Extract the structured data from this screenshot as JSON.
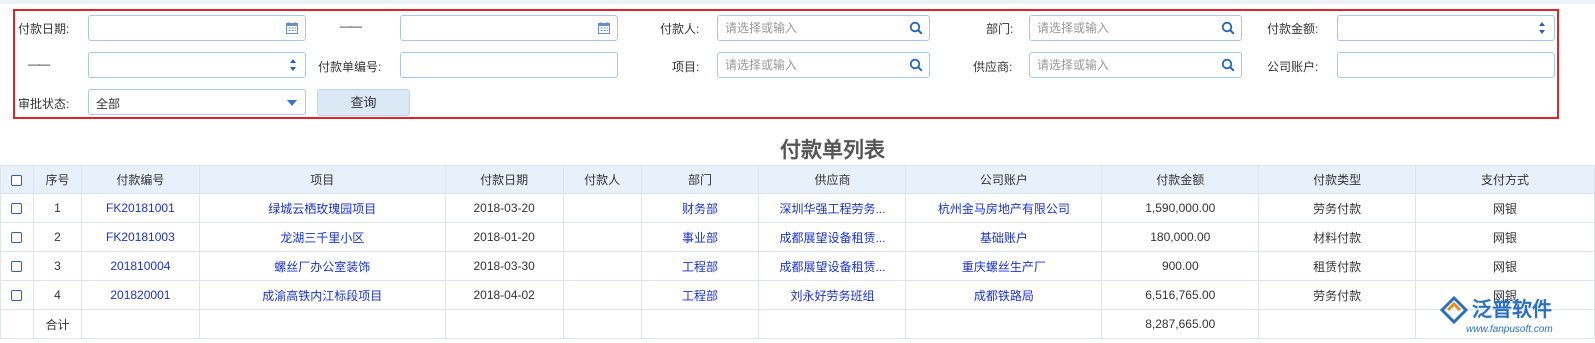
{
  "filters": {
    "payment_date_label": "付款日期:",
    "range_dash": "——",
    "payer_label": "付款人:",
    "payer_placeholder": "请选择或输入",
    "department_label": "部门:",
    "department_placeholder": "请选择或输入",
    "amount_label": "付款金额:",
    "amount_range_dash": "——",
    "doc_no_label": "付款单编号:",
    "project_label": "项目:",
    "project_placeholder": "请选择或输入",
    "supplier_label": "供应商:",
    "supplier_placeholder": "请选择或输入",
    "company_account_label": "公司账户:",
    "approval_label": "审批状态:",
    "approval_value": "全部",
    "query_button": "查询"
  },
  "list_title": "付款单列表",
  "table": {
    "headers": [
      "序号",
      "付款编号",
      "项目",
      "付款日期",
      "付款人",
      "部门",
      "供应商",
      "公司账户",
      "付款金额",
      "付款类型",
      "支付方式"
    ],
    "rows": [
      {
        "no": "1",
        "code": "FK20181001",
        "project": "绿城云栖玫瑰园项目",
        "date": "2018-03-20",
        "payer": "",
        "dept": "财务部",
        "supplier": "深圳华强工程劳务...",
        "account": "杭州金马房地产有限公司",
        "amount": "1,590,000.00",
        "type": "劳务付款",
        "method": "网银"
      },
      {
        "no": "2",
        "code": "FK20181003",
        "project": "龙湖三千里小区",
        "date": "2018-01-20",
        "payer": "",
        "dept": "事业部",
        "supplier": "成都展望设备租赁...",
        "account": "基础账户",
        "amount": "180,000.00",
        "type": "材料付款",
        "method": "网银"
      },
      {
        "no": "3",
        "code": "201810004",
        "project": "螺丝厂办公室装饰",
        "date": "2018-03-30",
        "payer": "",
        "dept": "工程部",
        "supplier": "成都展望设备租赁...",
        "account": "重庆螺丝生产厂",
        "amount": "900.00",
        "type": "租赁付款",
        "method": "网银"
      },
      {
        "no": "4",
        "code": "201820001",
        "project": "成渝高铁内江标段项目",
        "date": "2018-04-02",
        "payer": "",
        "dept": "工程部",
        "supplier": "刘永好劳务班组",
        "account": "成都铁路局",
        "amount": "6,516,765.00",
        "type": "劳务付款",
        "method": "网银"
      }
    ],
    "total_label": "合计",
    "total_amount": "8,287,665.00"
  },
  "logo": {
    "text": "泛普软件",
    "url_text": "www.fanpusoft.com"
  },
  "colors": {
    "highlight_border": "#e0242b",
    "link": "#1a32c8",
    "header_bg": "#e8f1fb",
    "field_border": "#a9c6e8"
  },
  "icons": [
    "calendar-icon",
    "search-icon",
    "spinner-icon",
    "dropdown-caret-icon",
    "checkbox-icon"
  ]
}
